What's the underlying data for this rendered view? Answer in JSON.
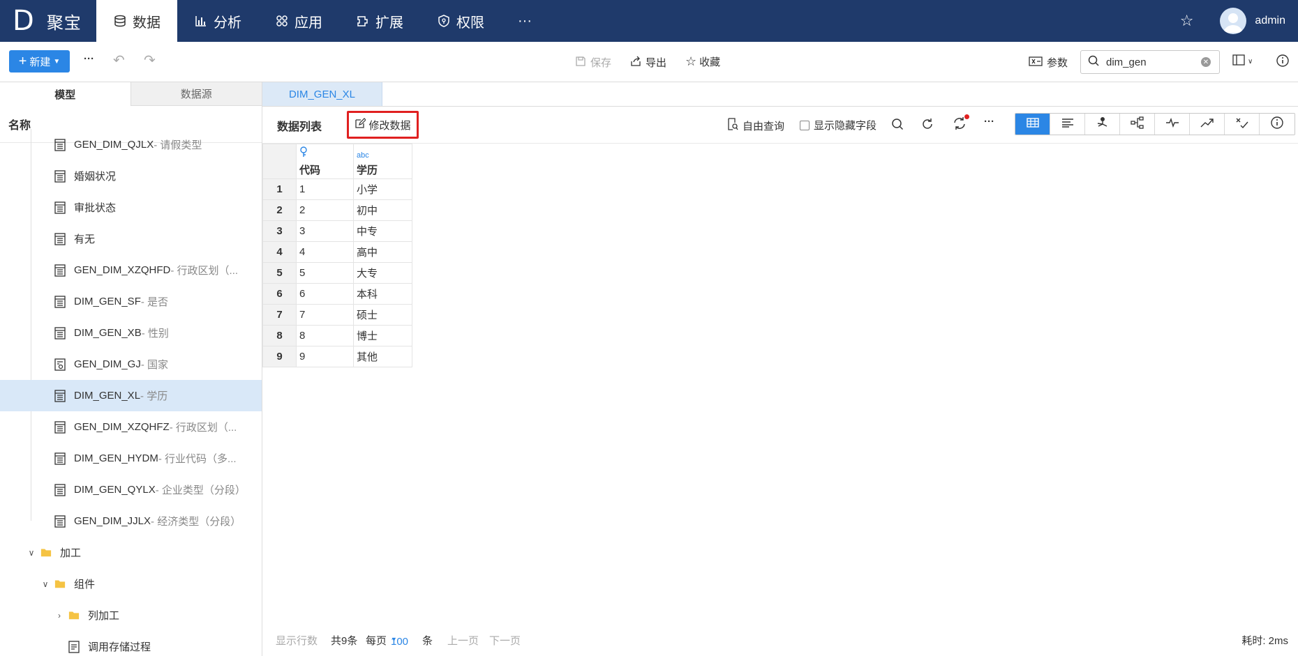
{
  "topnav": {
    "logo_letter": "D",
    "logo_name": "聚宝",
    "items": [
      {
        "label": "数据",
        "icon": "database-icon",
        "active": true
      },
      {
        "label": "分析",
        "icon": "bar-chart-icon",
        "active": false
      },
      {
        "label": "应用",
        "icon": "apps-icon",
        "active": false
      },
      {
        "label": "扩展",
        "icon": "extension-icon",
        "active": false
      },
      {
        "label": "权限",
        "icon": "shield-icon",
        "active": false
      }
    ],
    "more": "···",
    "user": "admin"
  },
  "toolbar": {
    "new_label": "新建",
    "more": "···",
    "save_label": "保存",
    "export_label": "导出",
    "favorite_label": "收藏",
    "params_label": "参数",
    "search_value": "dim_gen"
  },
  "left": {
    "tabs": [
      "模型",
      "数据源"
    ],
    "header": "名称",
    "items": [
      {
        "code": "GEN_DIM_QJLX",
        "desc": " - 请假类型"
      },
      {
        "code": "",
        "desc": "婚姻状况"
      },
      {
        "code": "",
        "desc": "审批状态"
      },
      {
        "code": "",
        "desc": "有无"
      },
      {
        "code": "GEN_DIM_XZQHFD",
        "desc": " - 行政区划（..."
      },
      {
        "code": "DIM_GEN_SF",
        "desc": " - 是否"
      },
      {
        "code": "DIM_GEN_XB",
        "desc": " - 性别"
      },
      {
        "code": "GEN_DIM_GJ",
        "desc": " - 国家"
      },
      {
        "code": "DIM_GEN_XL",
        "desc": " - 学历"
      },
      {
        "code": "GEN_DIM_XZQHFZ",
        "desc": " - 行政区划（..."
      },
      {
        "code": "DIM_GEN_HYDM",
        "desc": " - 行业代码（多..."
      },
      {
        "code": "DIM_GEN_QYLX",
        "desc": " - 企业类型（分段）"
      },
      {
        "code": "GEN_DIM_JJLX",
        "desc": " - 经济类型（分段）"
      }
    ],
    "folders": [
      "加工",
      "组件",
      "列加工"
    ],
    "last_item": "调用存储过程"
  },
  "doc_tab": "DIM_GEN_XL",
  "content": {
    "title": "数据列表",
    "edit_label": "修改数据",
    "free_query": "自由查询",
    "show_hidden": "显示隐藏字段",
    "more": "···",
    "columns": [
      {
        "type": "key-icon",
        "label": "代码"
      },
      {
        "type": "abc",
        "label": "学历"
      }
    ],
    "rows": [
      [
        "1",
        "1",
        "小学"
      ],
      [
        "2",
        "2",
        "初中"
      ],
      [
        "3",
        "3",
        "中专"
      ],
      [
        "4",
        "4",
        "高中"
      ],
      [
        "5",
        "5",
        "大专"
      ],
      [
        "6",
        "6",
        "本科"
      ],
      [
        "7",
        "7",
        "硕士"
      ],
      [
        "8",
        "8",
        "博士"
      ],
      [
        "9",
        "9",
        "其他"
      ]
    ]
  },
  "footer": {
    "show_rows": "显示行数",
    "total": "共9条",
    "per_page": "每页",
    "page_size": "100",
    "unit": "条",
    "prev": "上一页",
    "next": "下一页",
    "elapsed": "耗时: 2ms"
  },
  "colors": {
    "nav_bg": "#1f3a6b",
    "accent": "#2b86e5",
    "highlight": "#e02020",
    "selected_row": "#d9e8f8"
  }
}
